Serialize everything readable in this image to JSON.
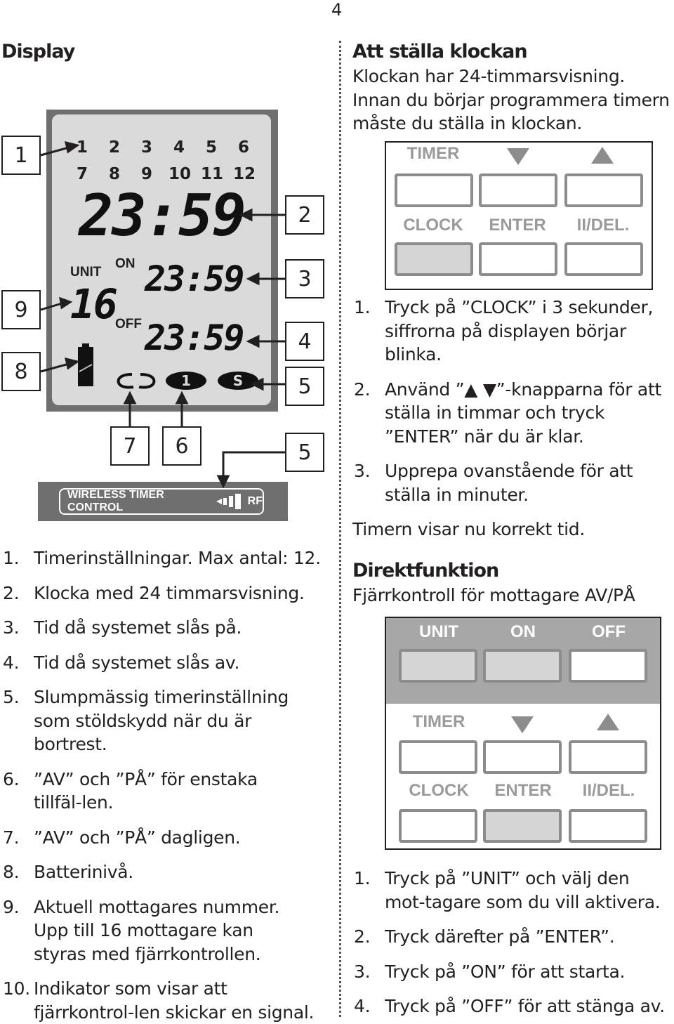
{
  "page_number": "4",
  "left": {
    "heading": "Display",
    "callouts": [
      "1",
      "2",
      "3",
      "4",
      "5",
      "5",
      "6",
      "7",
      "8",
      "9"
    ],
    "lcd": {
      "timer_numbers": [
        "1",
        "2",
        "3",
        "4",
        "5",
        "6",
        "7",
        "8",
        "9",
        "10",
        "11",
        "12"
      ],
      "clock": "23:59",
      "unit_label": "UNIT",
      "unit_value": "16",
      "on_label": "ON",
      "on_time": "23:59",
      "off_label": "OFF",
      "off_time": "23:59",
      "icons": [
        "repeat-daily-icon",
        "once-icon",
        "random-icon",
        "battery-icon"
      ],
      "once_symbol": "1",
      "random_symbol": "S"
    },
    "wireless_bar": {
      "label": "WIRELESS TIMER CONTROL",
      "rf": "RF"
    },
    "list": [
      {
        "n": "1.",
        "t": "Timerinställningar. Max antal: 12."
      },
      {
        "n": "2.",
        "t": "Klocka med 24 timmarsvisning."
      },
      {
        "n": "3.",
        "t": "Tid då systemet slås på."
      },
      {
        "n": "4.",
        "t": "Tid då systemet slås av."
      },
      {
        "n": "5.",
        "t": "Slumpmässig timerinställning som stöldskydd när du är bortrest."
      },
      {
        "n": "6.",
        "t": "”AV” och ”PÅ” för enstaka tillfäl-len."
      },
      {
        "n": "7.",
        "t": "”AV” och ”PÅ” dagligen."
      },
      {
        "n": "8.",
        "t": "Batterinivå."
      },
      {
        "n": "9.",
        "t": "Aktuell mottagares nummer. Upp till 16 mottagare kan styras med fjärrkontrollen."
      },
      {
        "n": "10.",
        "t": "Indikator som visar att fjärrkontrol-len skickar en signal."
      }
    ]
  },
  "right": {
    "section1": {
      "heading": "Att ställa klockan",
      "intro": "Klockan har 24-timmarsvisning. Innan du börjar programmera timern måste du ställa in klockan.",
      "panel": {
        "row1": [
          "TIMER",
          "▼",
          "▲"
        ],
        "row2": [
          "CLOCK",
          "ENTER",
          "II/DEL."
        ]
      },
      "steps": [
        {
          "n": "1.",
          "t": "Tryck på ”CLOCK” i 3 sekunder, siffrorna på displayen börjar blinka."
        },
        {
          "n": "2.",
          "t": "Använd ”▲ ▼”-knapparna för att ställa in timmar och tryck ”ENTER” när du är klar."
        },
        {
          "n": "3.",
          "t": "Upprepa ovanstående för att ställa in minuter."
        }
      ],
      "outro": "Timern visar nu korrekt tid."
    },
    "section2": {
      "heading": "Direktfunktion",
      "intro": "Fjärrkontroll för mottagare AV/PÅ",
      "panel": {
        "row0": [
          "UNIT",
          "ON",
          "OFF"
        ],
        "row1": [
          "TIMER",
          "▼",
          "▲"
        ],
        "row2": [
          "CLOCK",
          "ENTER",
          "II/DEL."
        ]
      },
      "steps": [
        {
          "n": "1.",
          "t": "Tryck på ”UNIT” och välj den mot-tagare som du vill aktivera."
        },
        {
          "n": "2.",
          "t": "Tryck därefter på ”ENTER”."
        },
        {
          "n": "3.",
          "t": "Tryck på ”ON” för att starta."
        },
        {
          "n": "4.",
          "t": "Tryck på ”OFF” för att stänga av."
        }
      ]
    }
  }
}
